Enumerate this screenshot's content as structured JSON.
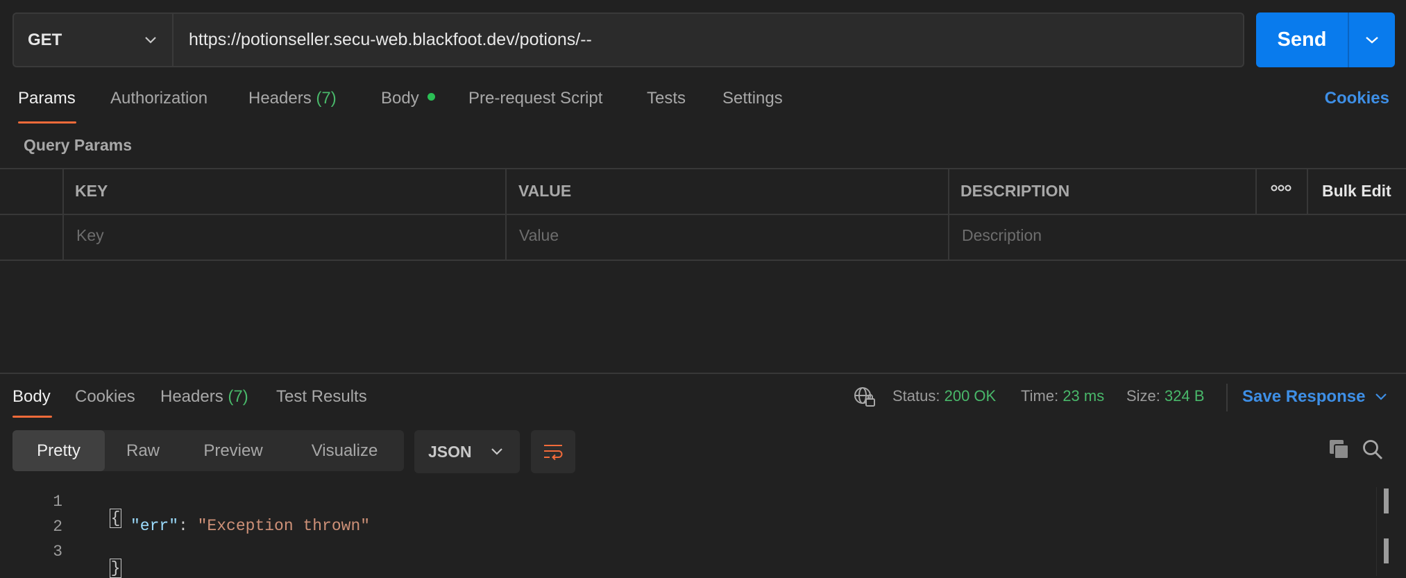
{
  "request": {
    "method": "GET",
    "url": "https://potionseller.secu-web.blackfoot.dev/potions/--",
    "send_label": "Send"
  },
  "request_tabs": {
    "params": "Params",
    "authorization": "Authorization",
    "headers": "Headers",
    "headers_count": "(7)",
    "body": "Body",
    "pre_request_script": "Pre-request Script",
    "tests": "Tests",
    "settings": "Settings",
    "cookies": "Cookies"
  },
  "query_params": {
    "title": "Query Params",
    "columns": {
      "key": "KEY",
      "value": "VALUE",
      "description": "DESCRIPTION",
      "bulk_edit": "Bulk Edit"
    },
    "placeholders": {
      "key": "Key",
      "value": "Value",
      "description": "Description"
    }
  },
  "response_tabs": {
    "body": "Body",
    "cookies": "Cookies",
    "headers": "Headers",
    "headers_count": "(7)",
    "test_results": "Test Results"
  },
  "response_meta": {
    "status_label": "Status:",
    "status_value": "200 OK",
    "time_label": "Time:",
    "time_value": "23 ms",
    "size_label": "Size:",
    "size_value": "324 B",
    "save_response": "Save Response"
  },
  "view_modes": {
    "pretty": "Pretty",
    "raw": "Raw",
    "preview": "Preview",
    "visualize": "Visualize",
    "format": "JSON"
  },
  "response_body": {
    "line_numbers": [
      "1",
      "2",
      "3"
    ],
    "open_brace": "{",
    "key": "\"err\"",
    "colon": ": ",
    "value": "\"Exception thrown\"",
    "close_brace": "}"
  },
  "colors": {
    "accent_orange": "#f26b3a",
    "send_blue": "#097bed",
    "link_blue": "#3e8fe6",
    "status_green": "#49b86a"
  }
}
